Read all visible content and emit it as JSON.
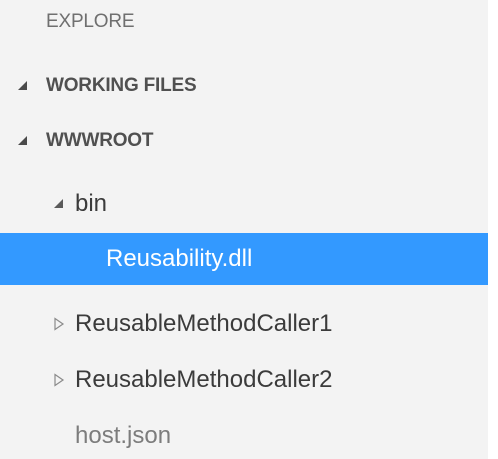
{
  "explorer": {
    "header": "EXPLORE",
    "sections": [
      {
        "label": "WORKING FILES",
        "expanded": true
      },
      {
        "label": "WWWROOT",
        "expanded": true
      }
    ],
    "tree": [
      {
        "label": "bin",
        "expanded": true
      },
      {
        "label": "Reusability.dll",
        "selected": true
      },
      {
        "label": "ReusableMethodCaller1",
        "expanded": false
      },
      {
        "label": "ReusableMethodCaller2",
        "expanded": false
      },
      {
        "label": "host.json"
      }
    ]
  },
  "colors": {
    "panel_bg": "#f3f3f3",
    "selection": "#3399ff",
    "text": "#3b3b3b",
    "section_text": "#505050"
  },
  "icons": {
    "expanded": "triangle-down-right-icon",
    "collapsed": "triangle-right-outline-icon"
  }
}
